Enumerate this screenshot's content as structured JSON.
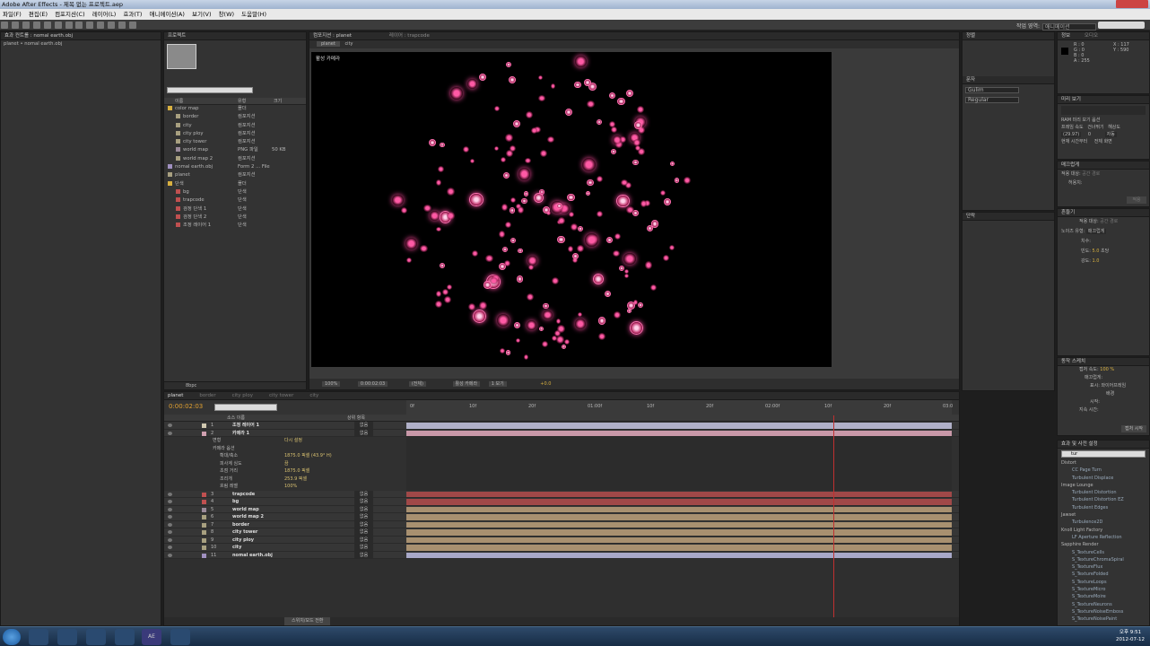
{
  "window": {
    "title": "Adobe After Effects - 제목 없는 프로젝트.aep"
  },
  "menu": [
    "파일(F)",
    "편집(E)",
    "컴포지션(C)",
    "레이어(L)",
    "효과(T)",
    "애니메이션(A)",
    "보기(V)",
    "창(W)",
    "도움말(H)"
  ],
  "workspace": {
    "label": "작업 영역:",
    "value": "애니메이션",
    "search_placeholder": "도움말 검색"
  },
  "effects_controls": {
    "tab": "효과 컨트롤 : nomal earth.obj",
    "breadcrumb": "planet • nomal earth.obj"
  },
  "project": {
    "tab": "프로젝트",
    "columns": [
      "이름",
      "유형",
      "크기"
    ],
    "items": [
      {
        "name": "color map",
        "type": "폴더",
        "size": "",
        "color": "#d8b040",
        "folder": true,
        "indent": 0
      },
      {
        "name": "border",
        "type": "컴포지션",
        "size": "",
        "color": "#a8a080",
        "indent": 1
      },
      {
        "name": "city",
        "type": "컴포지션",
        "size": "",
        "color": "#a8a080",
        "indent": 1
      },
      {
        "name": "city ploy",
        "type": "컴포지션",
        "size": "",
        "color": "#a8a080",
        "indent": 1
      },
      {
        "name": "city tower",
        "type": "컴포지션",
        "size": "",
        "color": "#a8a080",
        "indent": 1
      },
      {
        "name": "world map",
        "type": "PNG 파일",
        "size": "50 KB",
        "color": "#9a8a9a",
        "indent": 1
      },
      {
        "name": "world map 2",
        "type": "컴포지션",
        "size": "",
        "color": "#a8a080",
        "indent": 1
      },
      {
        "name": "nomal earth.obj",
        "type": "Form 2 ... File",
        "size": "",
        "color": "#a090c0",
        "indent": 0
      },
      {
        "name": "planet",
        "type": "컴포지션",
        "size": "",
        "color": "#a8a080",
        "indent": 0
      },
      {
        "name": "단색",
        "type": "폴더",
        "size": "",
        "color": "#d8b040",
        "folder": true,
        "indent": 0
      },
      {
        "name": "bg",
        "type": "단색",
        "size": "",
        "color": "#c05050",
        "indent": 1
      },
      {
        "name": "trapcode",
        "type": "단색",
        "size": "",
        "color": "#c05050",
        "indent": 1
      },
      {
        "name": "검정 단색 1",
        "type": "단색",
        "size": "",
        "color": "#c05050",
        "indent": 1
      },
      {
        "name": "검정 단색 2",
        "type": "단색",
        "size": "",
        "color": "#c05050",
        "indent": 1
      },
      {
        "name": "조정 레이어 1",
        "type": "단색",
        "size": "",
        "color": "#c05050",
        "indent": 1
      }
    ],
    "bpc": "8bpc"
  },
  "composition": {
    "tab": "컴포지션 : planet",
    "layer_tab": "레이어 : trapcode",
    "subtabs": [
      "planet",
      "city"
    ],
    "camera_label": "활성 카메라",
    "zoom": "100%",
    "timecode": "0:00:02:03",
    "resolution": "(전체)",
    "view_camera": "활성 카메라",
    "views": "1 보기",
    "exposure": "+0.0"
  },
  "timeline": {
    "tabs": [
      "planet",
      "border",
      "city ploy",
      "city tower",
      "city"
    ],
    "current_time": "0:00:02:03",
    "search_placeholder": "",
    "ruler": [
      "0f",
      "10f",
      "20f",
      "01:00f",
      "10f",
      "20f",
      "02:00f",
      "10f",
      "20f",
      "03:0"
    ],
    "columns": {
      "name": "소스 이름",
      "parent": "상위 항목"
    },
    "layers": [
      {
        "num": "1",
        "name": "조정 레이어 1",
        "color": "#d0c8b0",
        "parent": "없음",
        "bar": "#b0b0c8",
        "type": "adjust"
      },
      {
        "num": "2",
        "name": "카메라 1",
        "color": "#d0a0b0",
        "parent": "없음",
        "bar": "#c898a8",
        "type": "camera"
      },
      {
        "num": "3",
        "name": "trapcode",
        "color": "#c05050",
        "parent": "없음",
        "bar": "#a04848",
        "type": "solid"
      },
      {
        "num": "4",
        "name": "bg",
        "color": "#c05050",
        "parent": "없음",
        "bar": "#a04848",
        "type": "solid"
      },
      {
        "num": "5",
        "name": "world map",
        "color": "#9a8a9a",
        "parent": "없음",
        "bar": "#a89070",
        "type": "footage"
      },
      {
        "num": "6",
        "name": "world map 2",
        "color": "#a8a080",
        "parent": "없음",
        "bar": "#a89070",
        "type": "comp"
      },
      {
        "num": "7",
        "name": "border",
        "color": "#a8a080",
        "parent": "없음",
        "bar": "#a89070",
        "type": "comp"
      },
      {
        "num": "8",
        "name": "city tower",
        "color": "#a8a080",
        "parent": "없음",
        "bar": "#a89070",
        "type": "comp"
      },
      {
        "num": "9",
        "name": "city ploy",
        "color": "#a8a080",
        "parent": "없음",
        "bar": "#a89070",
        "type": "comp"
      },
      {
        "num": "10",
        "name": "city",
        "color": "#a8a080",
        "parent": "없음",
        "bar": "#a89070",
        "type": "comp"
      },
      {
        "num": "11",
        "name": "nomal earth.obj",
        "color": "#a090c0",
        "parent": "없음",
        "bar": "#a8a8c8",
        "type": "obj"
      }
    ],
    "camera_props": [
      {
        "label": "변형",
        "value": "",
        "indent": 0
      },
      {
        "label": "카메라 옵션",
        "value": "",
        "indent": 0
      },
      {
        "label": "확대/축소",
        "value": "1875.0 픽셀 (43.9° H)",
        "indent": 1
      },
      {
        "label": "피사계 심도",
        "value": "끔",
        "indent": 1
      },
      {
        "label": "초점 거리",
        "value": "1875.0 픽셀",
        "indent": 1
      },
      {
        "label": "조리개",
        "value": "253.9 픽셀",
        "indent": 1
      },
      {
        "label": "흐림 레벨",
        "value": "100%",
        "indent": 1
      }
    ],
    "reset_label": "다시 설정",
    "toggle_label": "스위치/모드 전환"
  },
  "right": {
    "info": {
      "tabs": [
        "정보",
        "오디오"
      ],
      "r": "R : 0",
      "g": "G : 0",
      "b": "B : 0",
      "a": "A : 255",
      "x": "X : 117",
      "y": "Y : 590"
    },
    "align_tab": "정렬",
    "character_tab": "문자",
    "paragraph_tab": "단락",
    "font": "Gulim",
    "style": "Regular",
    "preview": {
      "tab": "미리 보기",
      "ram": "RAM 미리 보기 옵션",
      "fps_label": "프레임 속도",
      "skip_label": "건너뛰기",
      "res_label": "해상도",
      "fps": "(29.97)",
      "skip": "0",
      "res": "자동",
      "from_current": "현재 시간부터",
      "full": "전체 화면"
    },
    "smoother": {
      "tab": "매끄럽게",
      "apply": "적용 대상:",
      "apply_val": "공간 경로",
      "tolerance": "허용치:",
      "apply_btn": "적용"
    },
    "wiggler": {
      "tab": "흔들기",
      "apply": "적용 대상:",
      "apply_val": "공간 경로",
      "noise": "노이즈 유형:",
      "noise_val": "매끄럽게",
      "dim": "치수:",
      "freq": "빈도:",
      "freq_val": "5.0",
      "freq_unit": "초당",
      "mag": "강도:",
      "mag_val": "1.0"
    },
    "motion": {
      "tab": "동작 스케치",
      "speed_label": "캡처 속도:",
      "speed": "100 %",
      "smooth": "매끄럽게:",
      "show": "표시:",
      "wireframe": "와이어프레임",
      "bg": "배경",
      "start": "시작:",
      "duration": "지속 시간:",
      "capture_btn": "캡처 시작"
    },
    "effects": {
      "tab": "효과 및 사전 설정",
      "search": "tur",
      "groups": [
        {
          "name": "Distort",
          "items": [
            "CC Page Turn",
            "Turbulent Displace"
          ]
        },
        {
          "name": "Image Lounge",
          "items": [
            "Turbulent Distortion",
            "Turbulent Distortion EZ",
            "Turbulent Edges"
          ]
        },
        {
          "name": "Jawset",
          "items": [
            "Turbulence2D"
          ]
        },
        {
          "name": "Knoll Light Factory",
          "items": [
            "LF Aperture Reflection"
          ]
        },
        {
          "name": "Sapphire Render",
          "items": [
            "S_TextureCells",
            "S_TextureChromaSpiral",
            "S_TextureFlux",
            "S_TextureFolded",
            "S_TextureLoops",
            "S_TextureMicro",
            "S_TextureMoire",
            "S_TextureNeurons",
            "S_TextureNoiseEmboss",
            "S_TextureNoisePaint"
          ]
        }
      ]
    }
  },
  "taskbar": {
    "time": "오후 9:51",
    "date": "2012-07-12"
  }
}
